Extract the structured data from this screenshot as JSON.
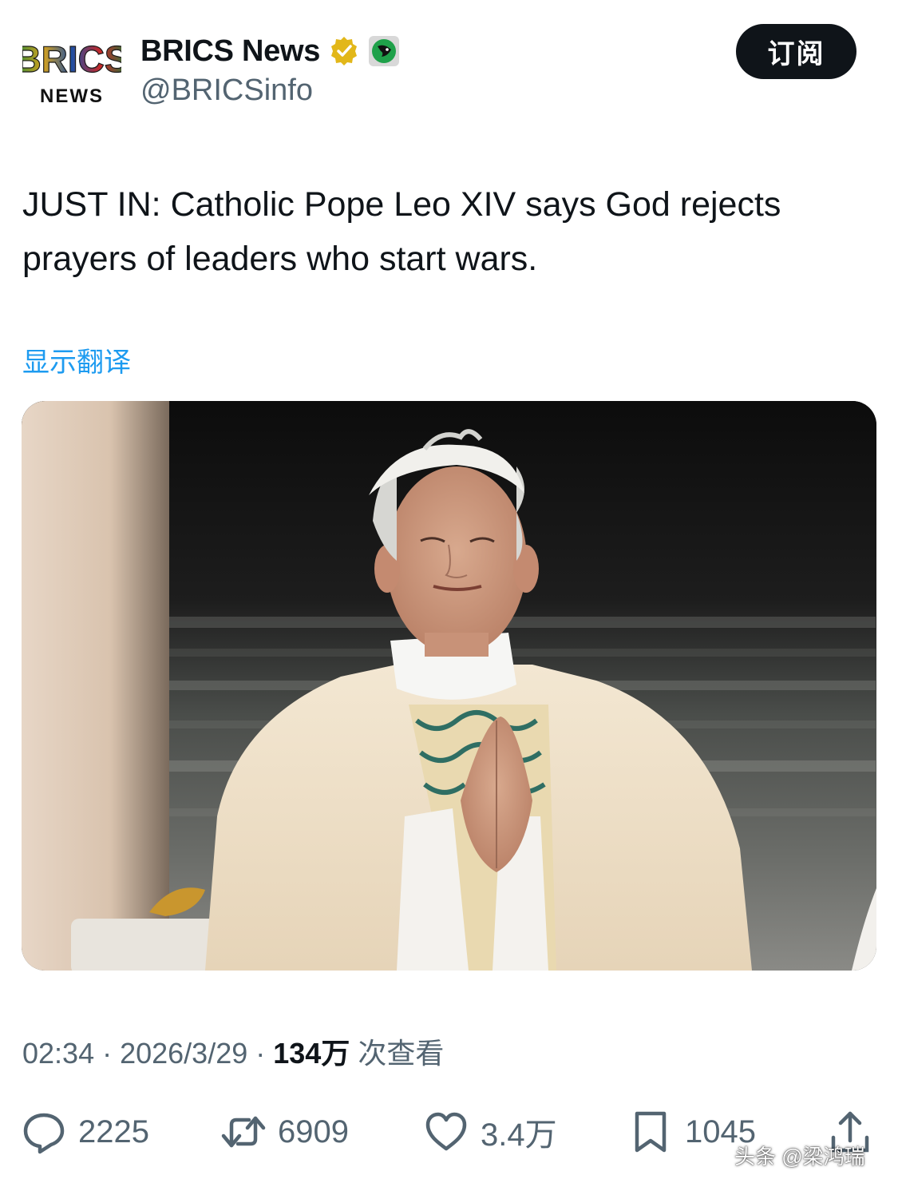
{
  "header": {
    "avatar_logo_top": "BRICS",
    "avatar_logo_bottom": "NEWS",
    "display_name": "BRICS News",
    "handle": "@BRICSinfo",
    "subscribe_label": "订阅",
    "verified_badge_icon": "verified-gold-badge-icon",
    "affiliate_icon": "grok-icon"
  },
  "post": {
    "text": "JUST IN: Catholic Pope Leo XIV says God rejects prayers of leaders who start wars.",
    "translate_label": "显示翻译"
  },
  "media": {
    "description_icon": "photo-pope-praying"
  },
  "meta": {
    "time": "02:34",
    "separator_1": " · ",
    "date": "2026/3/29",
    "separator_2": " · ",
    "views_count": "134万",
    "views_label": " 次查看"
  },
  "actions": {
    "reply_count": "2225",
    "retweet_count": "6909",
    "like_count": "3.4万",
    "bookmark_count": "1045",
    "reply_icon": "reply-icon",
    "retweet_icon": "retweet-icon",
    "like_icon": "heart-icon",
    "bookmark_icon": "bookmark-icon",
    "share_icon": "share-icon"
  },
  "watermark": "头条 @梁鸿瑞",
  "colors": {
    "text_primary": "#0f1419",
    "text_secondary": "#536471",
    "link": "#1d9bf0",
    "button_bg": "#0f1419",
    "badge_gold": "#e2b719"
  }
}
